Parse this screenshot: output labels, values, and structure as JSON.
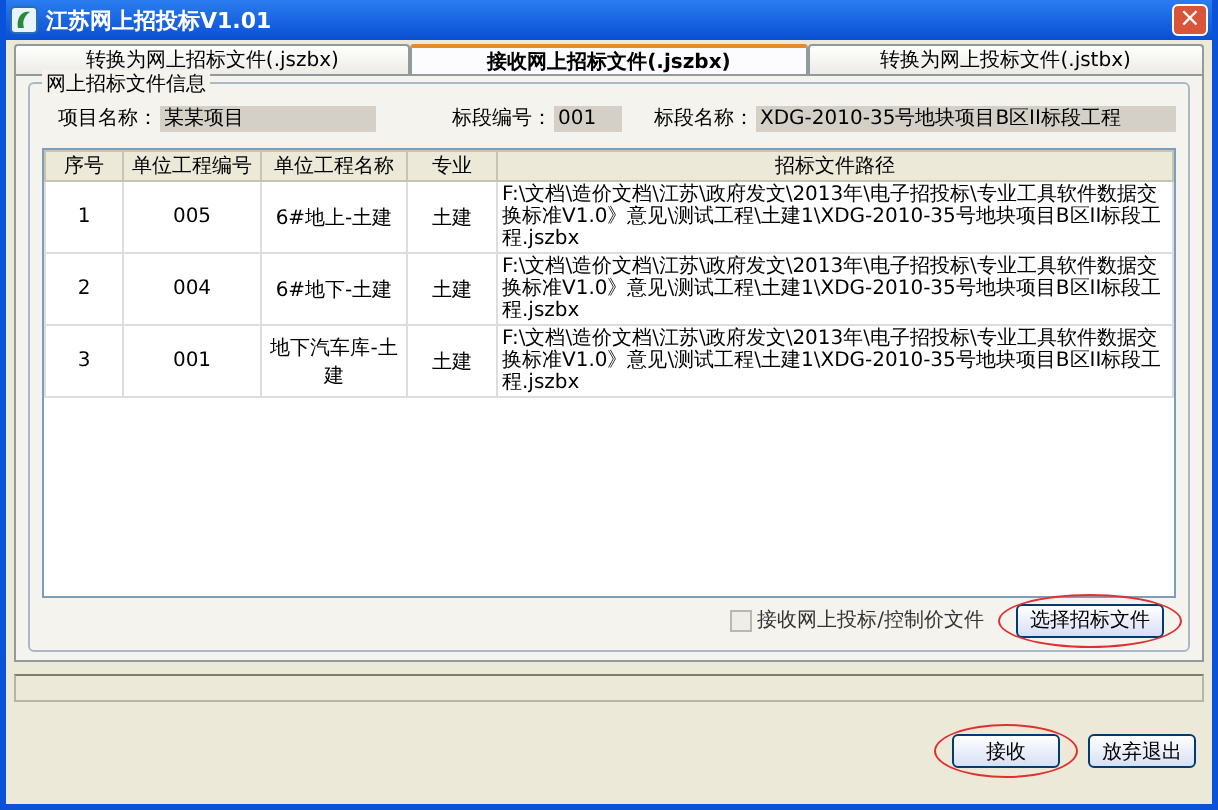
{
  "window": {
    "title": "江苏网上招投标V1.01",
    "close": "×"
  },
  "tabs": [
    {
      "label": "转换为网上招标文件(.jszbx)",
      "selected": false
    },
    {
      "label": "接收网上招标文件(.jszbx)",
      "selected": true
    },
    {
      "label": "转换为网上投标文件(.jstbx)",
      "selected": false
    }
  ],
  "group": {
    "title": "网上招标文件信息",
    "fields": [
      {
        "label": "项目名称：",
        "value": "某某项目"
      },
      {
        "label": "标段编号：",
        "value": "001"
      },
      {
        "label": "标段名称：",
        "value": "XDG-2010-35号地块项目B区II标段工程"
      }
    ],
    "table": {
      "columns": [
        "序号",
        "单位工程编号",
        "单位工程名称",
        "专业",
        "招标文件路径"
      ],
      "rows": [
        [
          "1",
          "005",
          "6#地上-土建",
          "土建",
          "F:\\文档\\造价文档\\江苏\\政府发文\\2013年\\电子招投标\\专业工具软件数据交换标准V1.0》意见\\测试工程\\土建1\\XDG-2010-35号地块项目B区II标段工程.jszbx"
        ],
        [
          "2",
          "004",
          "6#地下-土建",
          "土建",
          "F:\\文档\\造价文档\\江苏\\政府发文\\2013年\\电子招投标\\专业工具软件数据交换标准V1.0》意见\\测试工程\\土建1\\XDG-2010-35号地块项目B区II标段工程.jszbx"
        ],
        [
          "3",
          "001",
          "地下汽车库-土建",
          "土建",
          "F:\\文档\\造价文档\\江苏\\政府发文\\2013年\\电子招投标\\专业工具软件数据交换标准V1.0》意见\\测试工程\\土建1\\XDG-2010-35号地块项目B区II标段工程.jszbx"
        ]
      ]
    },
    "checkbox": {
      "label": "接收网上投标/控制价文件",
      "checked": false,
      "disabled": true
    },
    "select_button": {
      "label": "选择招标文件",
      "circled": true
    }
  },
  "buttons": [
    {
      "label": "接收",
      "circled": true
    },
    {
      "label": "放弃退出",
      "circled": false
    }
  ]
}
